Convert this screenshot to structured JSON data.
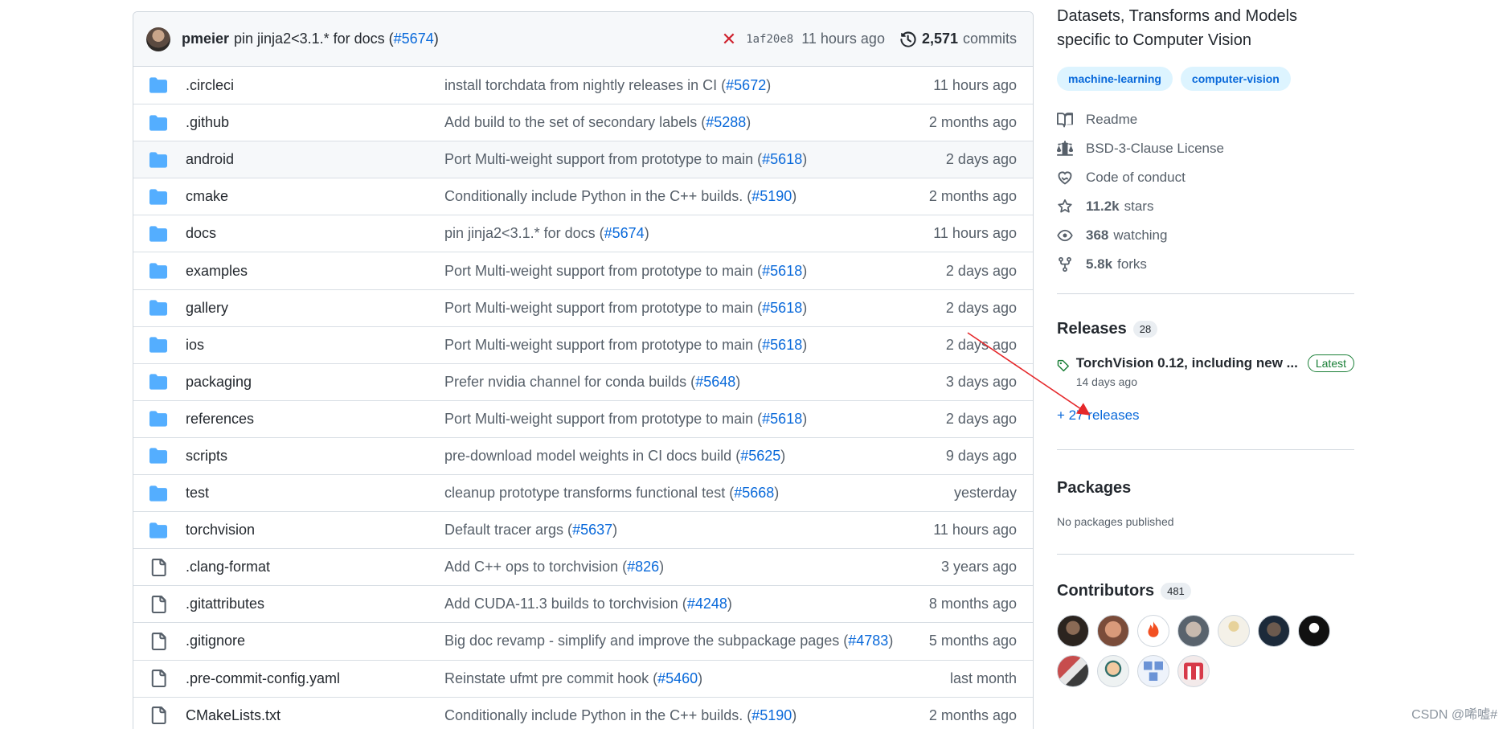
{
  "commit": {
    "author": "pmeier",
    "message": "pin jinja2<3.1.* for docs (",
    "pr": "#5674",
    "message_end": ")",
    "status_icon": "✕",
    "sha": "1af20e8",
    "time": "11 hours ago",
    "count": "2,571",
    "count_label": "commits"
  },
  "files": [
    {
      "type": "folder",
      "name": ".circleci",
      "msg": "install torchdata from nightly releases in CI (",
      "pr": "#5672",
      "end": ")",
      "time": "11 hours ago"
    },
    {
      "type": "folder",
      "name": ".github",
      "msg": "Add build to the set of secondary labels (",
      "pr": "#5288",
      "end": ")",
      "time": "2 months ago"
    },
    {
      "type": "folder",
      "name": "android",
      "msg": "Port Multi-weight support from prototype to main (",
      "pr": "#5618",
      "end": ")",
      "time": "2 days ago"
    },
    {
      "type": "folder",
      "name": "cmake",
      "msg": "Conditionally include Python in the C++ builds. (",
      "pr": "#5190",
      "end": ")",
      "time": "2 months ago"
    },
    {
      "type": "folder",
      "name": "docs",
      "msg": "pin jinja2<3.1.* for docs (",
      "pr": "#5674",
      "end": ")",
      "time": "11 hours ago"
    },
    {
      "type": "folder",
      "name": "examples",
      "msg": "Port Multi-weight support from prototype to main (",
      "pr": "#5618",
      "end": ")",
      "time": "2 days ago"
    },
    {
      "type": "folder",
      "name": "gallery",
      "msg": "Port Multi-weight support from prototype to main (",
      "pr": "#5618",
      "end": ")",
      "time": "2 days ago"
    },
    {
      "type": "folder",
      "name": "ios",
      "msg": "Port Multi-weight support from prototype to main (",
      "pr": "#5618",
      "end": ")",
      "time": "2 days ago"
    },
    {
      "type": "folder",
      "name": "packaging",
      "msg": "Prefer nvidia channel for conda builds (",
      "pr": "#5648",
      "end": ")",
      "time": "3 days ago"
    },
    {
      "type": "folder",
      "name": "references",
      "msg": "Port Multi-weight support from prototype to main (",
      "pr": "#5618",
      "end": ")",
      "time": "2 days ago"
    },
    {
      "type": "folder",
      "name": "scripts",
      "msg": "pre-download model weights in CI docs build (",
      "pr": "#5625",
      "end": ")",
      "time": "9 days ago"
    },
    {
      "type": "folder",
      "name": "test",
      "msg": "cleanup prototype transforms functional test (",
      "pr": "#5668",
      "end": ")",
      "time": "yesterday"
    },
    {
      "type": "folder",
      "name": "torchvision",
      "msg": "Default tracer args (",
      "pr": "#5637",
      "end": ")",
      "time": "11 hours ago"
    },
    {
      "type": "file",
      "name": ".clang-format",
      "msg": "Add C++ ops to torchvision (",
      "pr": "#826",
      "end": ")",
      "time": "3 years ago"
    },
    {
      "type": "file",
      "name": ".gitattributes",
      "msg": "Add CUDA-11.3 builds to torchvision (",
      "pr": "#4248",
      "end": ")",
      "time": "8 months ago"
    },
    {
      "type": "file",
      "name": ".gitignore",
      "msg": "Big doc revamp - simplify and improve the subpackage pages (",
      "pr": "#4783",
      "end": ")",
      "time": "5 months ago"
    },
    {
      "type": "file",
      "name": ".pre-commit-config.yaml",
      "msg": "Reinstate ufmt pre commit hook (",
      "pr": "#5460",
      "end": ")",
      "time": "last month"
    },
    {
      "type": "file",
      "name": "CMakeLists.txt",
      "msg": "Conditionally include Python in the C++ builds. (",
      "pr": "#5190",
      "end": ")",
      "time": "2 months ago"
    }
  ],
  "sidebar": {
    "about": "Datasets, Transforms and Models specific to Computer Vision",
    "topics": [
      "machine-learning",
      "computer-vision"
    ],
    "readme": "Readme",
    "license": "BSD-3-Clause License",
    "conduct": "Code of conduct",
    "stars_count": "11.2k",
    "stars_label": "stars",
    "watching_count": "368",
    "watching_label": "watching",
    "forks_count": "5.8k",
    "forks_label": "forks",
    "releases_title": "Releases",
    "releases_count": "28",
    "release_name": "TorchVision 0.12, including new ...",
    "latest_label": "Latest",
    "release_date": "14 days ago",
    "more_releases": "+ 27 releases",
    "packages_title": "Packages",
    "no_packages": "No packages published",
    "contributors_title": "Contributors",
    "contributors_count": "481"
  },
  "colors": {
    "link": "#0969da",
    "folder": "#54aeff",
    "annotation_arrow": "#e5282b"
  },
  "watermark": "CSDN @唏嘘#"
}
